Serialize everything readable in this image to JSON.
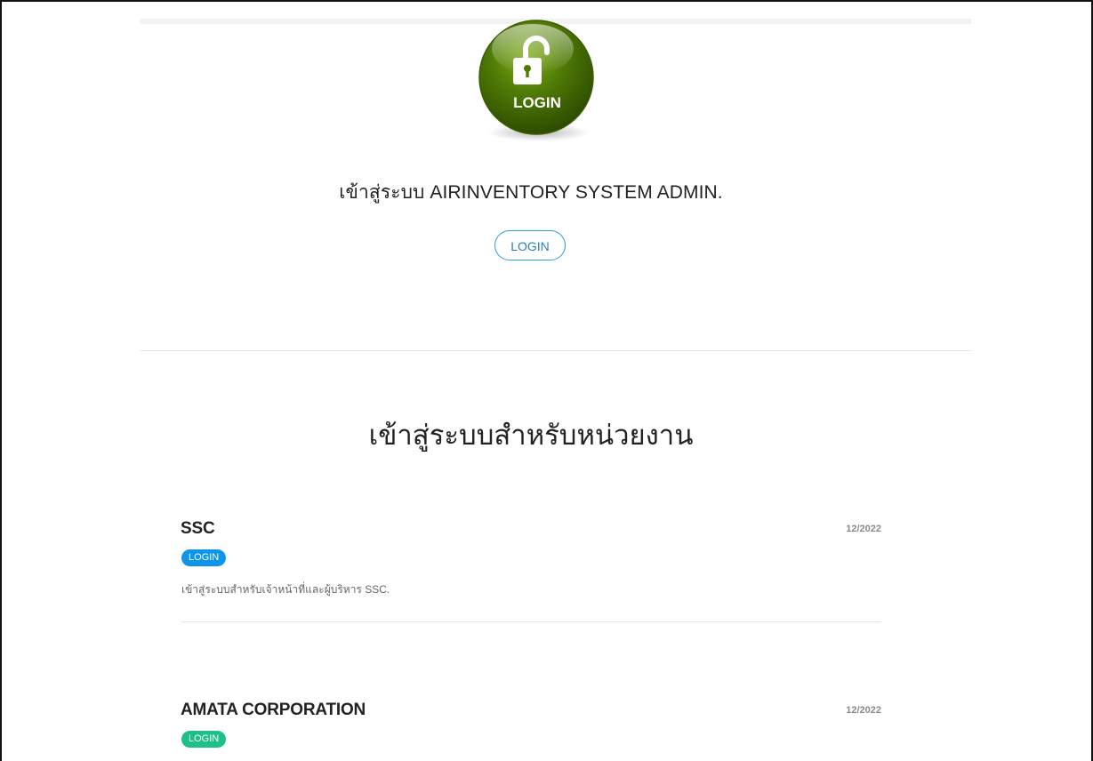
{
  "logo": {
    "label": "LOGIN"
  },
  "hero": {
    "title": "เข้าสู่ระบบ AIRINVENTORY SYSTEM ADMIN.",
    "button_label": "LOGIN"
  },
  "section": {
    "title": "เข้าสู่ระบบสำหรับหน่วยงาน"
  },
  "orgs": [
    {
      "name": "SSC",
      "date": "12/2022",
      "badge": "LOGIN",
      "badge_color": "#0e95ea",
      "description": "เข้าสู่ระบบสำหรับเจ้าหน้าที่และผู้บริหาร SSC."
    },
    {
      "name": "AMATA CORPORATION",
      "date": "12/2022",
      "badge": "LOGIN",
      "badge_color": "#1fbf8a",
      "description": ""
    }
  ],
  "colors": {
    "accent_blue": "#2a9fd6",
    "logo_green": "#4f7a05"
  }
}
